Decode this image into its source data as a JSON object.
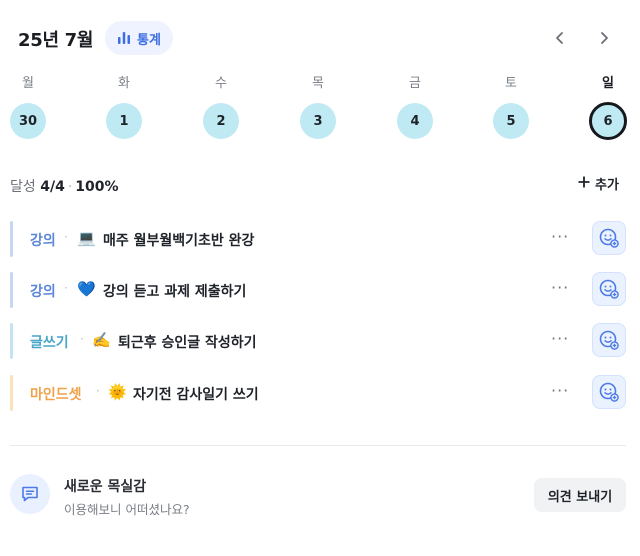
{
  "header": {
    "month_title": "25년 7월",
    "stats_label": "통계",
    "accent_color": "#3d6fe0"
  },
  "week": {
    "days": [
      {
        "weekday": "월",
        "date": "30"
      },
      {
        "weekday": "화",
        "date": "1"
      },
      {
        "weekday": "수",
        "date": "2"
      },
      {
        "weekday": "목",
        "date": "3"
      },
      {
        "weekday": "금",
        "date": "4"
      },
      {
        "weekday": "토",
        "date": "5"
      },
      {
        "weekday": "일",
        "date": "6",
        "selected": true
      }
    ],
    "day_color": "#bfeaf3"
  },
  "summary": {
    "label": "달성",
    "count": "4/4",
    "percent": "100%",
    "add_label": "추가"
  },
  "tasks": [
    {
      "category": "강의",
      "emoji": "💻",
      "title": "매주 월부월백기초반 완강",
      "color": "#5b86d9",
      "bar_color": "#c9d6f2"
    },
    {
      "category": "강의",
      "emoji": "💙",
      "title": "강의 듣고 과제 제출하기",
      "color": "#5b86d9",
      "bar_color": "#c9d6f2"
    },
    {
      "category": "글쓰기",
      "emoji": "✍️",
      "title": "퇴근후 승인글 작성하기",
      "color": "#4aa6c9",
      "bar_color": "#c3e4f0"
    },
    {
      "category": "마인드셋",
      "emoji": "🌞",
      "title": "자기전 감사일기 쓰기",
      "color": "#f0a24a",
      "bar_color": "#fbe0bd"
    }
  ],
  "footer": {
    "title": "새로운 목실감",
    "subtitle": "이용해보니 어떠셨나요?",
    "button_label": "의견 보내기"
  }
}
